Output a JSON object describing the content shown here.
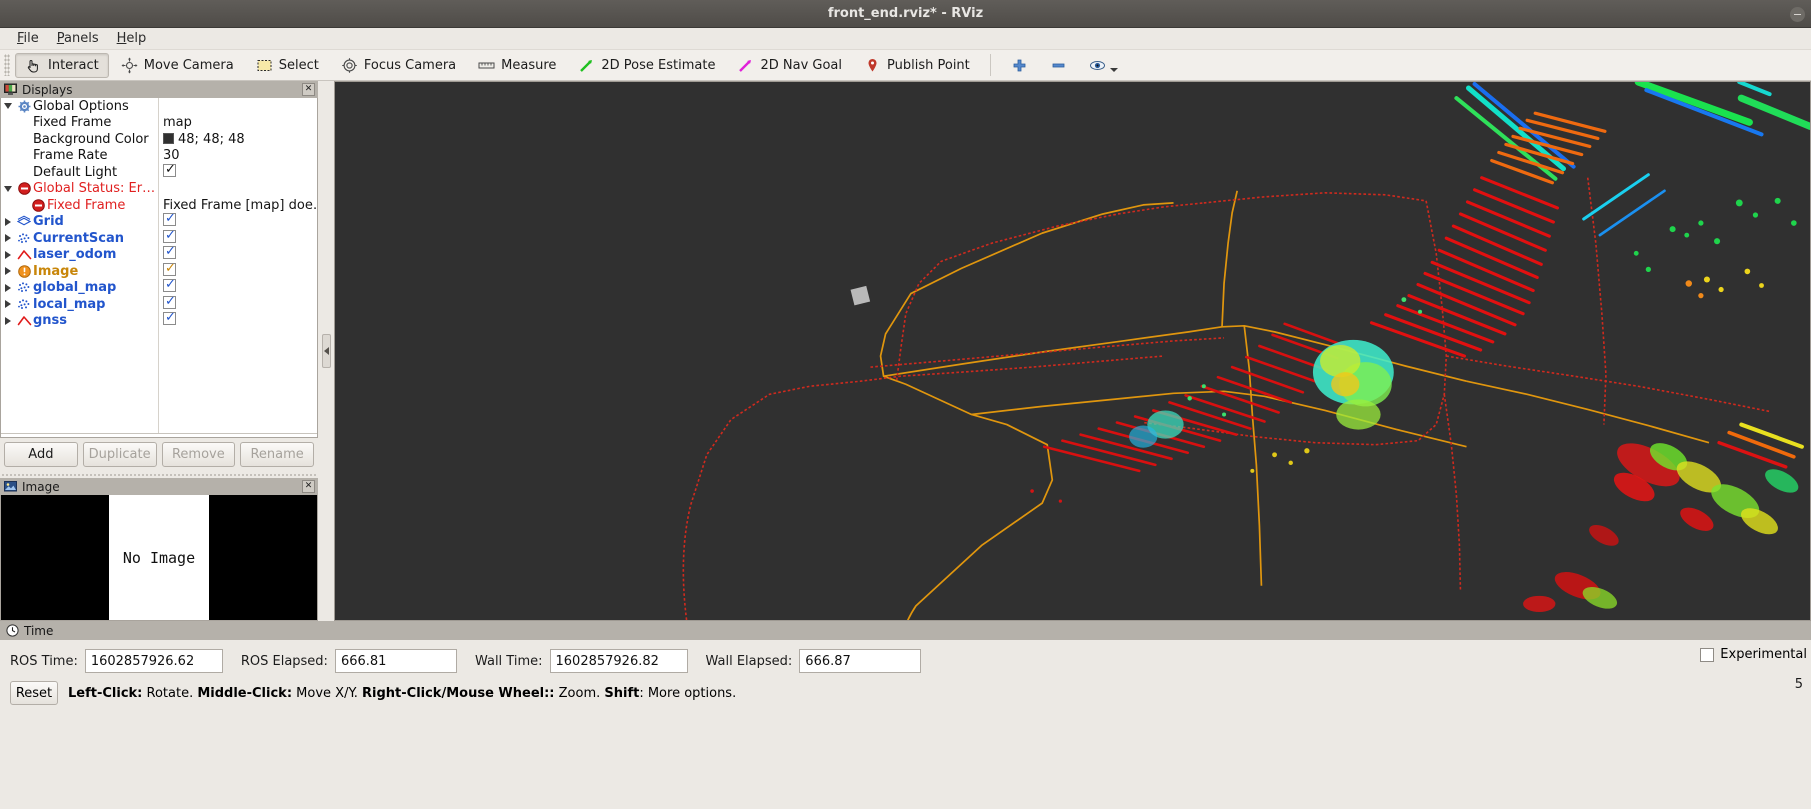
{
  "window": {
    "title": "front_end.rviz* - RViz"
  },
  "menu": {
    "items": [
      {
        "label": "File",
        "mnemonic": "F"
      },
      {
        "label": "Panels",
        "mnemonic": "P"
      },
      {
        "label": "Help",
        "mnemonic": "H"
      }
    ]
  },
  "toolbar": {
    "items": [
      {
        "label": "Interact",
        "icon": "hand-cursor-icon",
        "checked": true
      },
      {
        "label": "Move Camera",
        "icon": "move-camera-icon",
        "checked": false
      },
      {
        "label": "Select",
        "icon": "select-rect-icon",
        "checked": false
      },
      {
        "label": "Focus Camera",
        "icon": "focus-camera-icon",
        "checked": false
      },
      {
        "label": "Measure",
        "icon": "ruler-icon",
        "checked": false
      },
      {
        "label": "2D Pose Estimate",
        "icon": "green-arrow-icon",
        "checked": false
      },
      {
        "label": "2D Nav Goal",
        "icon": "magenta-arrow-icon",
        "checked": false
      },
      {
        "label": "Publish Point",
        "icon": "map-pin-icon",
        "checked": false
      }
    ],
    "extra": [
      {
        "icon": "plus-icon",
        "label": ""
      },
      {
        "icon": "minus-icon",
        "label": ""
      },
      {
        "icon": "eye-icon",
        "label": ""
      }
    ]
  },
  "displays_panel": {
    "title": "Displays",
    "rows": [
      {
        "id": "global-options",
        "label": "Global Options",
        "label_style": "plain",
        "indent": 0,
        "arrow": "down",
        "icon": "gear-icon",
        "value_type": "none",
        "value": ""
      },
      {
        "id": "fixed-frame",
        "label": "Fixed Frame",
        "label_style": "plain",
        "indent": 1,
        "arrow": "none",
        "icon": "none",
        "value_type": "text",
        "value": "map"
      },
      {
        "id": "background-color",
        "label": "Background Color",
        "label_style": "plain",
        "indent": 1,
        "arrow": "none",
        "icon": "none",
        "value_type": "color",
        "value": "48; 48; 48",
        "color": "#303030"
      },
      {
        "id": "frame-rate",
        "label": "Frame Rate",
        "label_style": "plain",
        "indent": 1,
        "arrow": "none",
        "icon": "none",
        "value_type": "text",
        "value": "30"
      },
      {
        "id": "default-light",
        "label": "Default Light",
        "label_style": "plain",
        "indent": 1,
        "arrow": "none",
        "icon": "none",
        "value_type": "checkbox-dark",
        "value": ""
      },
      {
        "id": "global-status",
        "label": "Global Status: Er…",
        "label_style": "red",
        "indent": 0,
        "arrow": "down",
        "icon": "error-icon",
        "value_type": "none",
        "value": ""
      },
      {
        "id": "status-fixed-frame",
        "label": "Fixed Frame",
        "label_style": "red",
        "indent": 1,
        "arrow": "none",
        "icon": "error-icon",
        "value_type": "text",
        "value": "Fixed Frame [map] doe…"
      },
      {
        "id": "grid",
        "label": "Grid",
        "label_style": "blue",
        "indent": 0,
        "arrow": "right",
        "icon": "grid-icon",
        "value_type": "checkbox",
        "value": ""
      },
      {
        "id": "currentscan",
        "label": "CurrentScan",
        "label_style": "blue",
        "indent": 0,
        "arrow": "right",
        "icon": "pointcloud-icon",
        "value_type": "checkbox",
        "value": ""
      },
      {
        "id": "laser-odom",
        "label": "laser_odom",
        "label_style": "blue",
        "indent": 0,
        "arrow": "right",
        "icon": "path-icon",
        "value_type": "checkbox",
        "value": ""
      },
      {
        "id": "image",
        "label": "Image",
        "label_style": "orange",
        "indent": 0,
        "arrow": "right",
        "icon": "warning-icon",
        "value_type": "checkbox-orange",
        "value": ""
      },
      {
        "id": "global-map",
        "label": "global_map",
        "label_style": "blue",
        "indent": 0,
        "arrow": "right",
        "icon": "pointcloud-icon",
        "value_type": "checkbox",
        "value": ""
      },
      {
        "id": "local-map",
        "label": "local_map",
        "label_style": "blue",
        "indent": 0,
        "arrow": "right",
        "icon": "pointcloud-icon",
        "value_type": "checkbox",
        "value": ""
      },
      {
        "id": "gnss",
        "label": "gnss",
        "label_style": "blue",
        "indent": 0,
        "arrow": "right",
        "icon": "path-icon",
        "value_type": "checkbox",
        "value": ""
      }
    ],
    "buttons": [
      {
        "label": "Add",
        "enabled": true
      },
      {
        "label": "Duplicate",
        "enabled": false
      },
      {
        "label": "Remove",
        "enabled": false
      },
      {
        "label": "Rename",
        "enabled": false
      }
    ]
  },
  "image_panel": {
    "title": "Image",
    "placeholder": "No Image"
  },
  "time_panel": {
    "title": "Time",
    "fields": [
      {
        "label": "ROS Time:",
        "value": "1602857926.62",
        "width": "w1"
      },
      {
        "label": "ROS Elapsed:",
        "value": "666.81",
        "width": "w2"
      },
      {
        "label": "Wall Time:",
        "value": "1602857926.82",
        "width": "w1"
      },
      {
        "label": "Wall Elapsed:",
        "value": "666.87",
        "width": "w2"
      }
    ],
    "reset_label": "Reset",
    "hint_parts": [
      {
        "text": "Left-Click:",
        "bold": true
      },
      {
        "text": " Rotate. ",
        "bold": false
      },
      {
        "text": "Middle-Click:",
        "bold": true
      },
      {
        "text": " Move X/Y. ",
        "bold": false
      },
      {
        "text": "Right-Click/Mouse Wheel::",
        "bold": true
      },
      {
        "text": " Zoom. ",
        "bold": false
      },
      {
        "text": "Shift",
        "bold": true
      },
      {
        "text": ": More options.",
        "bold": false
      }
    ],
    "experimental_label": "Experimental",
    "experimental_checked": false,
    "fps": "5"
  },
  "viewport": {
    "background": "#303030",
    "paths": [
      {
        "name": "laser_odom-path",
        "color": "#e0960e"
      },
      {
        "name": "gnss-path",
        "color": "#d02a1e"
      }
    ],
    "robot_marker_color": "#b9b9b9"
  }
}
